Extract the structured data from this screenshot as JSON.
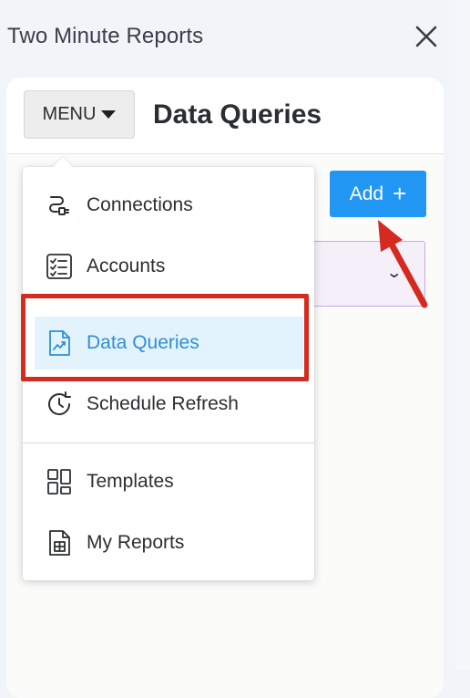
{
  "app": {
    "title": "Two Minute Reports"
  },
  "header": {
    "menu_label": "MENU",
    "page_title": "Data Queries"
  },
  "toolbar": {
    "add_label": "Add"
  },
  "menu": {
    "items": [
      {
        "label": "Connections",
        "icon": "connections-icon"
      },
      {
        "label": "Accounts",
        "icon": "checklist-icon"
      },
      {
        "label": "Data Queries",
        "icon": "chart-file-icon",
        "active": true
      },
      {
        "label": "Schedule Refresh",
        "icon": "clock-refresh-icon"
      },
      {
        "label": "Templates",
        "icon": "grid-icon"
      },
      {
        "label": "My Reports",
        "icon": "report-file-icon"
      }
    ]
  },
  "colors": {
    "accent": "#2196f3",
    "active_bg": "#e3f3fb",
    "active_text": "#2f8fd6",
    "annotation": "#d42a1f"
  }
}
